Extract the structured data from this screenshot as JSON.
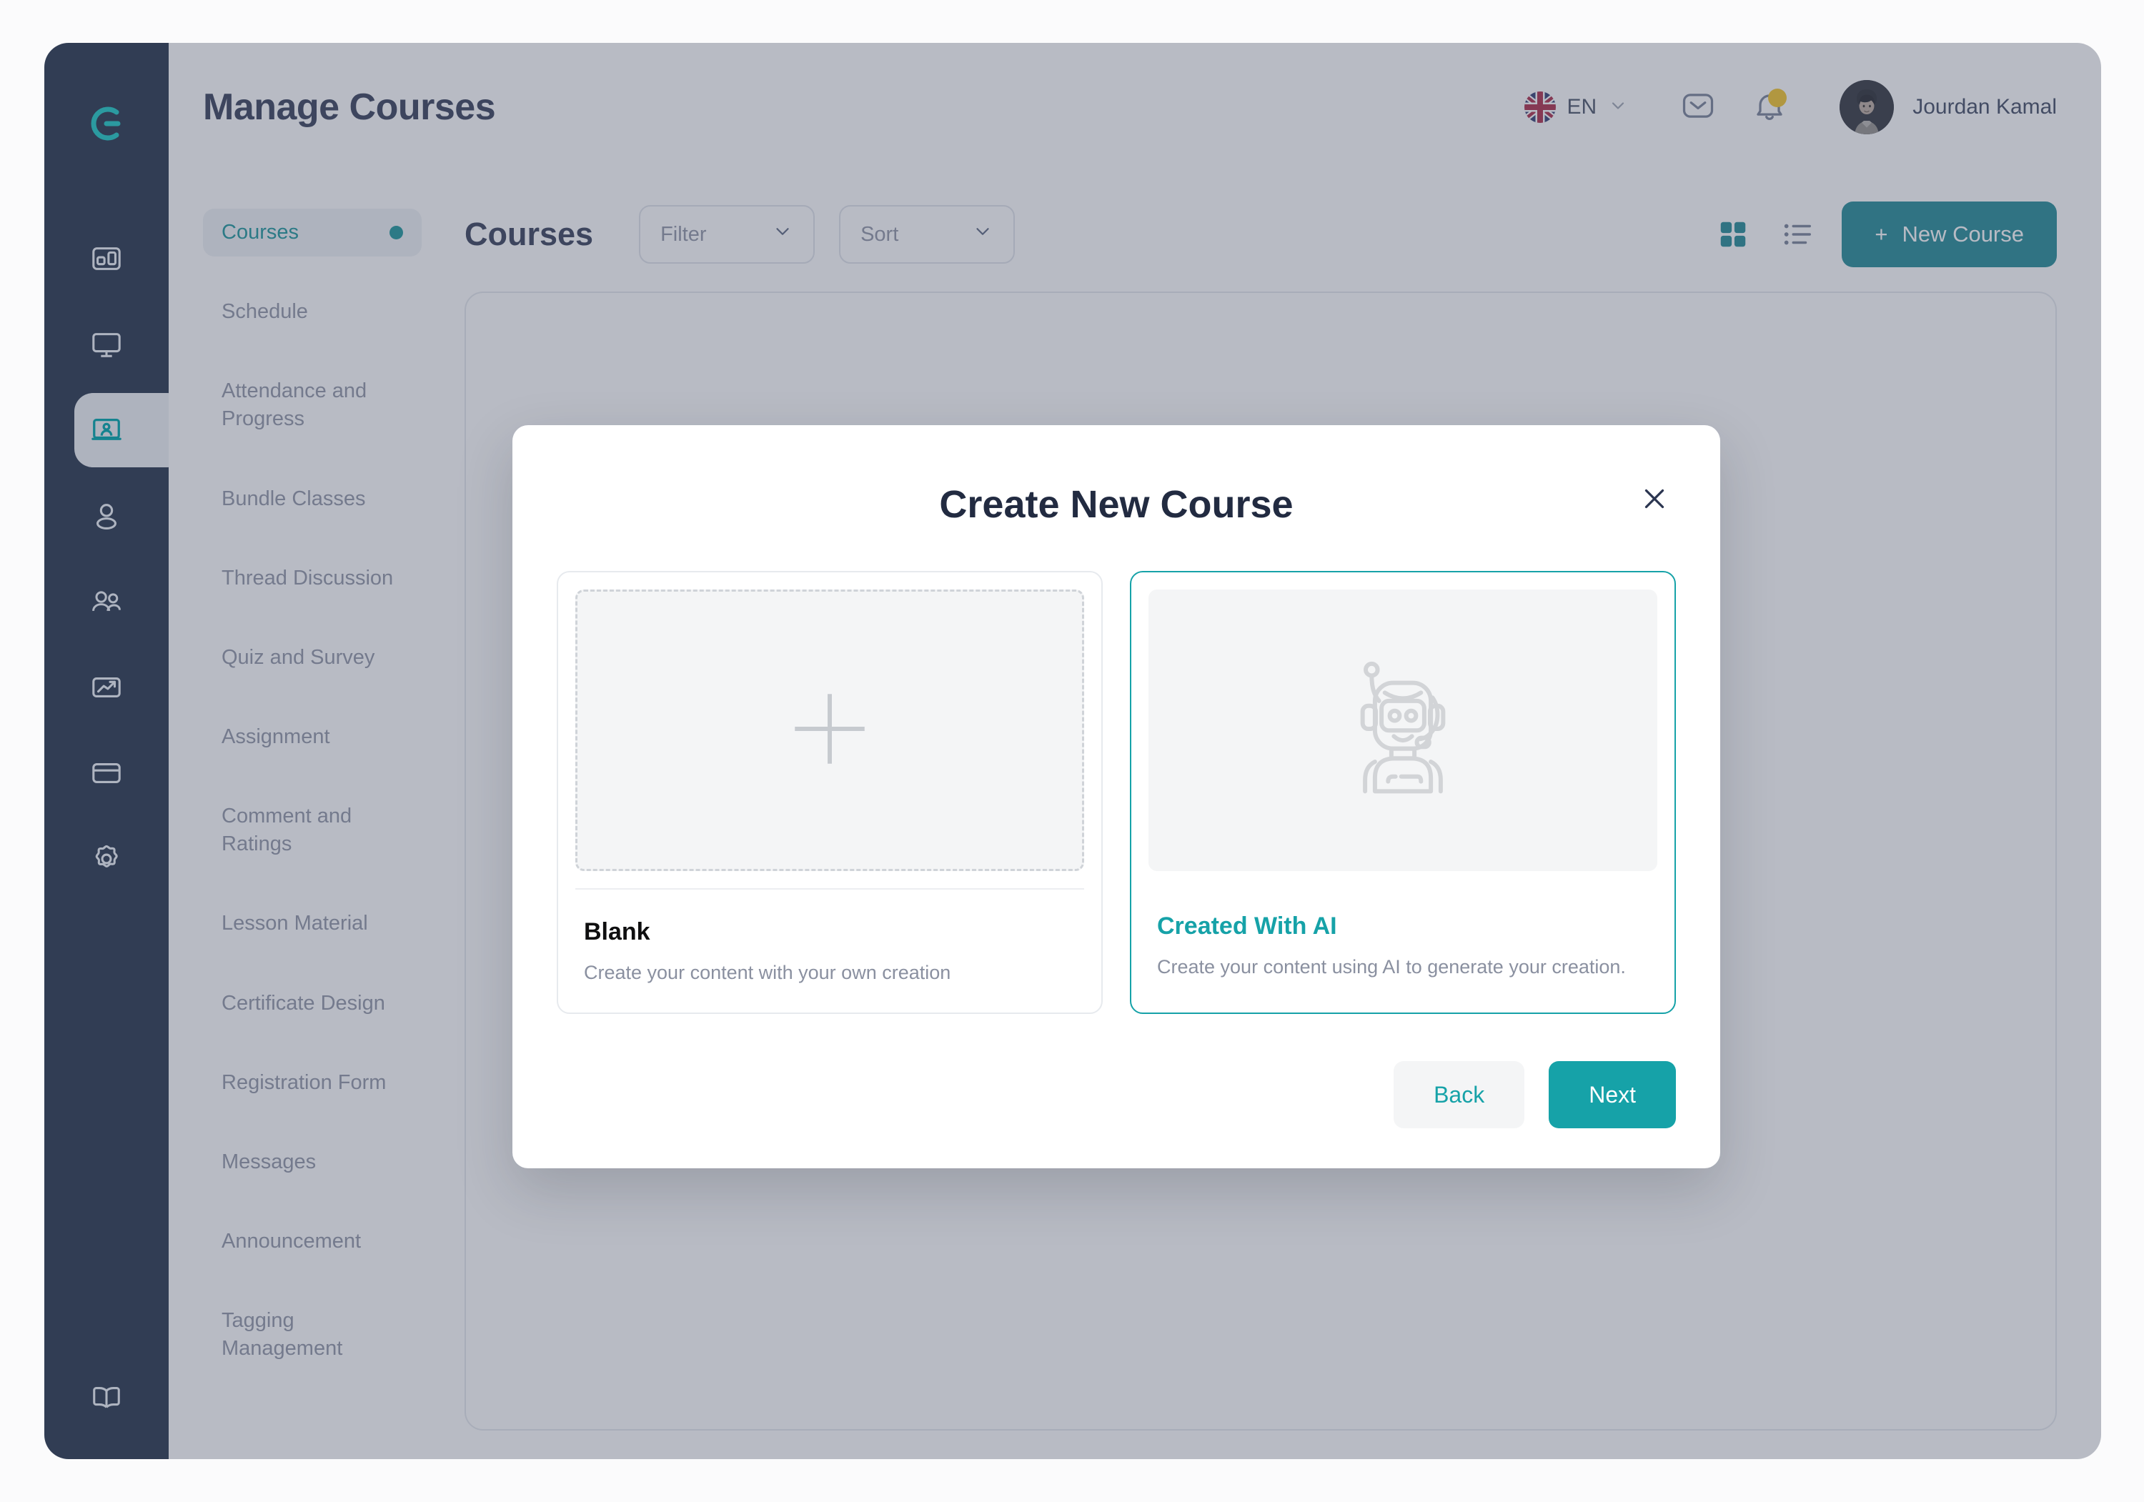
{
  "header": {
    "title": "Manage Courses",
    "language": {
      "code": "EN",
      "flag_icon": "uk-flag-icon"
    },
    "mail_icon": "mail-icon",
    "notification_icon": "bell-icon",
    "notification_badge": true,
    "user": {
      "name": "Jourdan Kamal",
      "avatar_icon": "avatar"
    }
  },
  "rail": {
    "logo_icon": "brand-logo-icon",
    "items": [
      {
        "icon": "dashboard-icon",
        "active": false
      },
      {
        "icon": "monitor-icon",
        "active": false
      },
      {
        "icon": "classroom-icon",
        "active": true
      },
      {
        "icon": "user-icon",
        "active": false
      },
      {
        "icon": "users-group-icon",
        "active": false
      },
      {
        "icon": "trending-chart-icon",
        "active": false
      },
      {
        "icon": "credit-card-icon",
        "active": false
      },
      {
        "icon": "gear-icon",
        "active": false
      }
    ],
    "bottom_item": {
      "icon": "book-icon"
    }
  },
  "submenu": {
    "items": [
      {
        "label": "Courses",
        "active": true
      },
      {
        "label": "Schedule",
        "active": false
      },
      {
        "label": "Attendance and Progress",
        "active": false
      },
      {
        "label": "Bundle Classes",
        "active": false
      },
      {
        "label": "Thread Discussion",
        "active": false
      },
      {
        "label": "Quiz and Survey",
        "active": false
      },
      {
        "label": "Assignment",
        "active": false
      },
      {
        "label": "Comment and Ratings",
        "active": false
      },
      {
        "label": "Lesson Material",
        "active": false
      },
      {
        "label": "Certificate Design",
        "active": false
      },
      {
        "label": "Registration Form",
        "active": false
      },
      {
        "label": "Messages",
        "active": false
      },
      {
        "label": "Announcement",
        "active": false
      },
      {
        "label": "Tagging Management",
        "active": false
      }
    ]
  },
  "content": {
    "section_title": "Courses",
    "filter_label": "Filter",
    "sort_label": "Sort",
    "grid_view_icon": "grid-view-icon",
    "list_view_icon": "list-view-icon",
    "new_course_label": "New Course",
    "new_course_plus": "+"
  },
  "modal": {
    "title": "Create New Course",
    "close_icon": "close-icon",
    "options": [
      {
        "id": "blank",
        "title": "Blank",
        "description": "Create your content with your own creation",
        "thumb_icon": "plus-icon",
        "selected": false
      },
      {
        "id": "ai",
        "title": "Created With AI",
        "description": "Create your content using AI to generate your creation.",
        "thumb_icon": "robot-icon",
        "selected": true
      }
    ],
    "back_label": "Back",
    "next_label": "Next"
  },
  "colors": {
    "brand_teal": "#16a2a8",
    "deep_teal": "#15838f",
    "sidebar_navy": "#313d54",
    "title_navy": "#2b3550",
    "muted_grey": "#8a90a0",
    "badge_yellow": "#f3c21c"
  }
}
